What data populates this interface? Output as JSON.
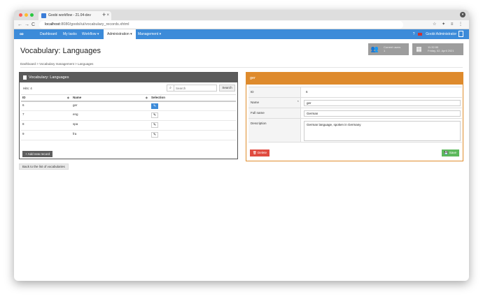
{
  "browser": {
    "tab_title": "Goobi workflow - 21.04-dev",
    "tab_close": "×",
    "new_tab": "+",
    "url_host": "localhost",
    "url_path": ":8080/goobi/ui/vocabulary_records.xhtml",
    "nav_back": "←",
    "nav_forward": "→",
    "nav_reload": "C",
    "right_icons": "☆ ✦ ≡ ⋮",
    "dots_colors": [
      "#ff5f57",
      "#febc2e",
      "#28c840"
    ]
  },
  "appnav": {
    "logo": "∞",
    "items": [
      {
        "label": "Dashboard"
      },
      {
        "label": "My tasks"
      },
      {
        "label": "Workflow ▾"
      },
      {
        "label": "Administration ▾"
      },
      {
        "label": "Management ▾"
      }
    ],
    "active_index": 3,
    "help_icon": "?",
    "user": "Goobi Administrator"
  },
  "page": {
    "title": "Vocabulary: Languages",
    "users_box": {
      "label": "Current users",
      "count": "1"
    },
    "date_box": {
      "time": "11:32:55",
      "date": "Friday, 02. April 2021"
    },
    "breadcrumb": "Dashboard  >  Vocabulary management  >  Languages"
  },
  "left_panel": {
    "title": "Vocabulary: Languages",
    "hits": "Hits: 4",
    "search_placeholder": "Search",
    "search_button": "Search",
    "columns": [
      "ID",
      "Name",
      "Selection"
    ],
    "rows": [
      {
        "id": "6",
        "name": "ger",
        "selected": true
      },
      {
        "id": "7",
        "name": "eng",
        "selected": false
      },
      {
        "id": "8",
        "name": "spa",
        "selected": false
      },
      {
        "id": "9",
        "name": "fra",
        "selected": false
      }
    ],
    "add_button": "+ Add new record"
  },
  "back_button": "Back to the list of vocabularies",
  "right_panel": {
    "title": "ger",
    "fields": {
      "id_label": "ID",
      "id_value": "6",
      "name_label": "Name",
      "name_required": "*",
      "name_value": "ger",
      "fullname_label": "Full name",
      "fullname_value": "German",
      "desc_label": "Description",
      "desc_value": "German language, spoken in Germany"
    },
    "delete_button": "Delete",
    "save_button": "Save"
  },
  "colors": {
    "nav_blue": "#3c8bd9",
    "panel_dark": "#5b5b5b",
    "panel_orange": "#de8a2c",
    "delete_red": "#e04b40",
    "save_green": "#5cb85c"
  }
}
